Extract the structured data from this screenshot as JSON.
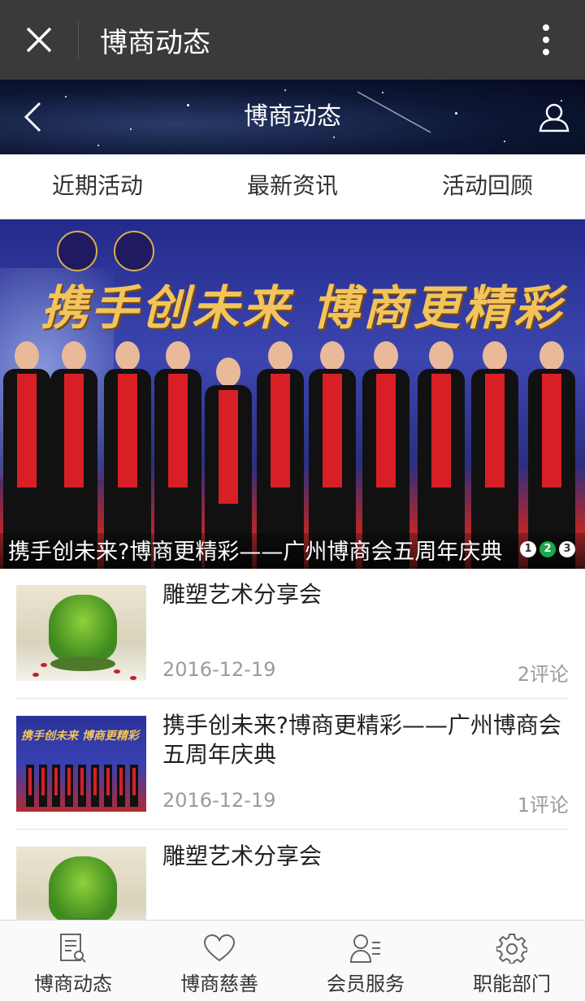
{
  "wechat_bar": {
    "title": "博商动态"
  },
  "header": {
    "title": "博商动态"
  },
  "tabs": [
    {
      "label": "近期活动"
    },
    {
      "label": "最新资讯"
    },
    {
      "label": "活动回顾"
    }
  ],
  "banner": {
    "caption": "携手创未来?博商更精彩——广州博商会五周年庆典",
    "sign_text": "携手创未来  博商更精彩",
    "dots": [
      "1",
      "2",
      "3"
    ],
    "active_dot": 2
  },
  "articles": [
    {
      "title": "雕塑艺术分享会",
      "date": "2016-12-19",
      "comments": "2评论",
      "thumb": "plant"
    },
    {
      "title": "携手创未来?博商更精彩——广州博商会五周年庆典",
      "date": "2016-12-19",
      "comments": "1评论",
      "thumb": "event"
    },
    {
      "title": "雕塑艺术分享会",
      "date": "",
      "comments": "",
      "thumb": "plant"
    }
  ],
  "bottom_nav": [
    {
      "label": "博商动态",
      "icon": "document-search-icon"
    },
    {
      "label": "博商慈善",
      "icon": "heart-icon"
    },
    {
      "label": "会员服务",
      "icon": "member-list-icon"
    },
    {
      "label": "职能部门",
      "icon": "gear-icon"
    }
  ],
  "colors": {
    "wechat_bar": "#3a3a3a",
    "active_dot": "#1aa84b",
    "meta_text": "#9b9b9b"
  }
}
